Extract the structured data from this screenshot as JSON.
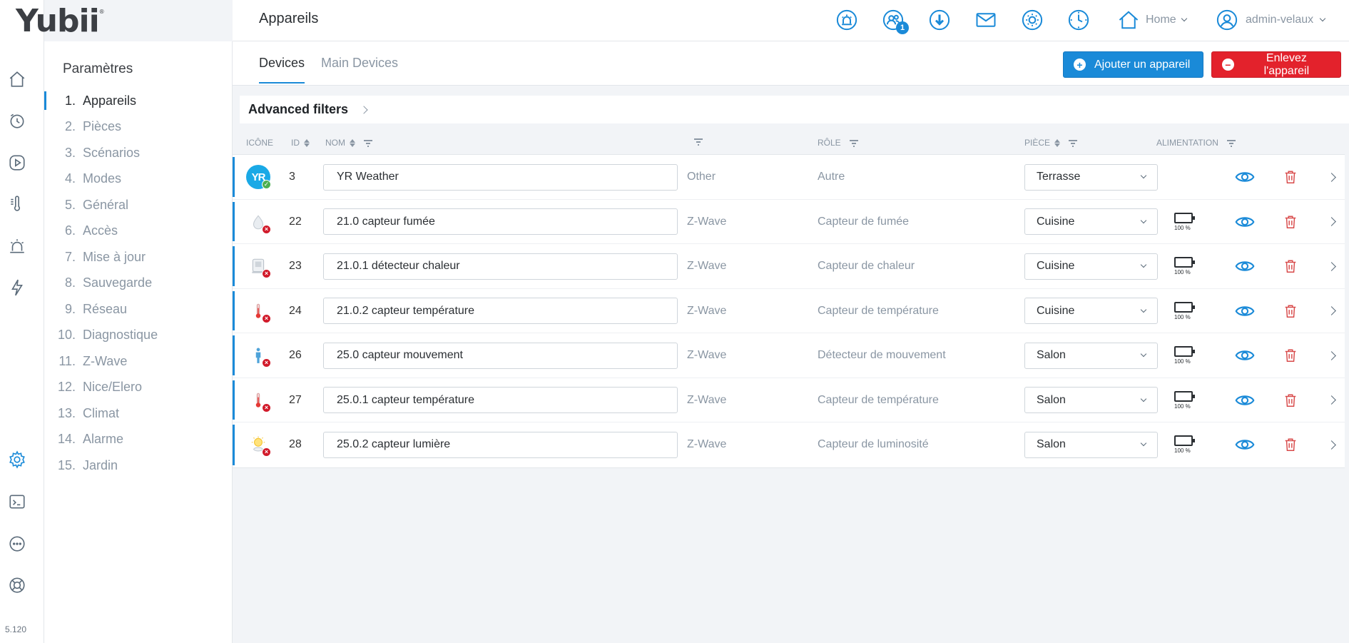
{
  "brand": {
    "logo": "Yubii",
    "reg": "®"
  },
  "version": "5.120",
  "rail": {
    "icons": [
      "home-icon",
      "clock-icon",
      "play-icon",
      "thermometer-icon",
      "alarm-icon",
      "lightning-icon",
      "gear-icon",
      "terminal-icon",
      "more-icon",
      "help-icon"
    ],
    "active": "gear-icon"
  },
  "params": {
    "title": "Paramètres",
    "items": [
      {
        "num": "1.",
        "label": "Appareils"
      },
      {
        "num": "2.",
        "label": "Pièces"
      },
      {
        "num": "3.",
        "label": "Scénarios"
      },
      {
        "num": "4.",
        "label": "Modes"
      },
      {
        "num": "5.",
        "label": "Général"
      },
      {
        "num": "6.",
        "label": "Accès"
      },
      {
        "num": "7.",
        "label": "Mise à jour"
      },
      {
        "num": "8.",
        "label": "Sauvegarde"
      },
      {
        "num": "9.",
        "label": "Réseau"
      },
      {
        "num": "10.",
        "label": "Diagnostique"
      },
      {
        "num": "11.",
        "label": "Z-Wave"
      },
      {
        "num": "12.",
        "label": "Nice/Elero"
      },
      {
        "num": "13.",
        "label": "Climat"
      },
      {
        "num": "14.",
        "label": "Alarme"
      },
      {
        "num": "15.",
        "label": "Jardin"
      }
    ],
    "active_index": 0
  },
  "header": {
    "title": "Appareils",
    "notif_badge": "1",
    "home_label": "Home",
    "user_label": "admin-velaux"
  },
  "tabs": [
    {
      "label": "Devices",
      "active": true
    },
    {
      "label": "Main Devices",
      "active": false
    }
  ],
  "actions": {
    "add_label": "Ajouter un appareil",
    "remove_label": "Enlevez l'appareil",
    "add_symbol": "+",
    "remove_symbol": "−"
  },
  "filters": {
    "label": "Advanced filters"
  },
  "columns": {
    "icon": "ICÔNE",
    "id": "ID",
    "name": "NOM",
    "role": "RÔLE",
    "room": "PIÈCE",
    "power": "ALIMENTATION"
  },
  "colors": {
    "accent": "#1a8ad8",
    "danger": "#e3222c",
    "battery": "#62c10f"
  },
  "devices": [
    {
      "id": "3",
      "name": "YR Weather",
      "protocol": "Other",
      "role": "Autre",
      "room": "Terrasse",
      "icon": "yr-weather-icon",
      "icon_text": "YR",
      "status": "ok",
      "battery": ""
    },
    {
      "id": "22",
      "name": "21.0 capteur fumée",
      "protocol": "Z-Wave",
      "role": "Capteur de fumée",
      "room": "Cuisine",
      "icon": "smoke-sensor-icon",
      "status": "error",
      "battery": "100 %"
    },
    {
      "id": "23",
      "name": "21.0.1 détecteur chaleur",
      "protocol": "Z-Wave",
      "role": "Capteur de chaleur",
      "room": "Cuisine",
      "icon": "heat-sensor-icon",
      "status": "error",
      "battery": "100 %"
    },
    {
      "id": "24",
      "name": "21.0.2 capteur température",
      "protocol": "Z-Wave",
      "role": "Capteur de température",
      "room": "Cuisine",
      "icon": "thermometer-icon",
      "status": "error",
      "battery": "100 %"
    },
    {
      "id": "26",
      "name": "25.0 capteur mouvement",
      "protocol": "Z-Wave",
      "role": "Détecteur de mouvement",
      "room": "Salon",
      "icon": "motion-sensor-icon",
      "status": "error",
      "battery": "100 %"
    },
    {
      "id": "27",
      "name": "25.0.1 capteur température",
      "protocol": "Z-Wave",
      "role": "Capteur de température",
      "room": "Salon",
      "icon": "thermometer-icon",
      "status": "error",
      "battery": "100 %"
    },
    {
      "id": "28",
      "name": "25.0.2 capteur lumière",
      "protocol": "Z-Wave",
      "role": "Capteur de luminosité",
      "room": "Salon",
      "icon": "light-sensor-icon",
      "status": "error",
      "battery": "100 %"
    }
  ]
}
